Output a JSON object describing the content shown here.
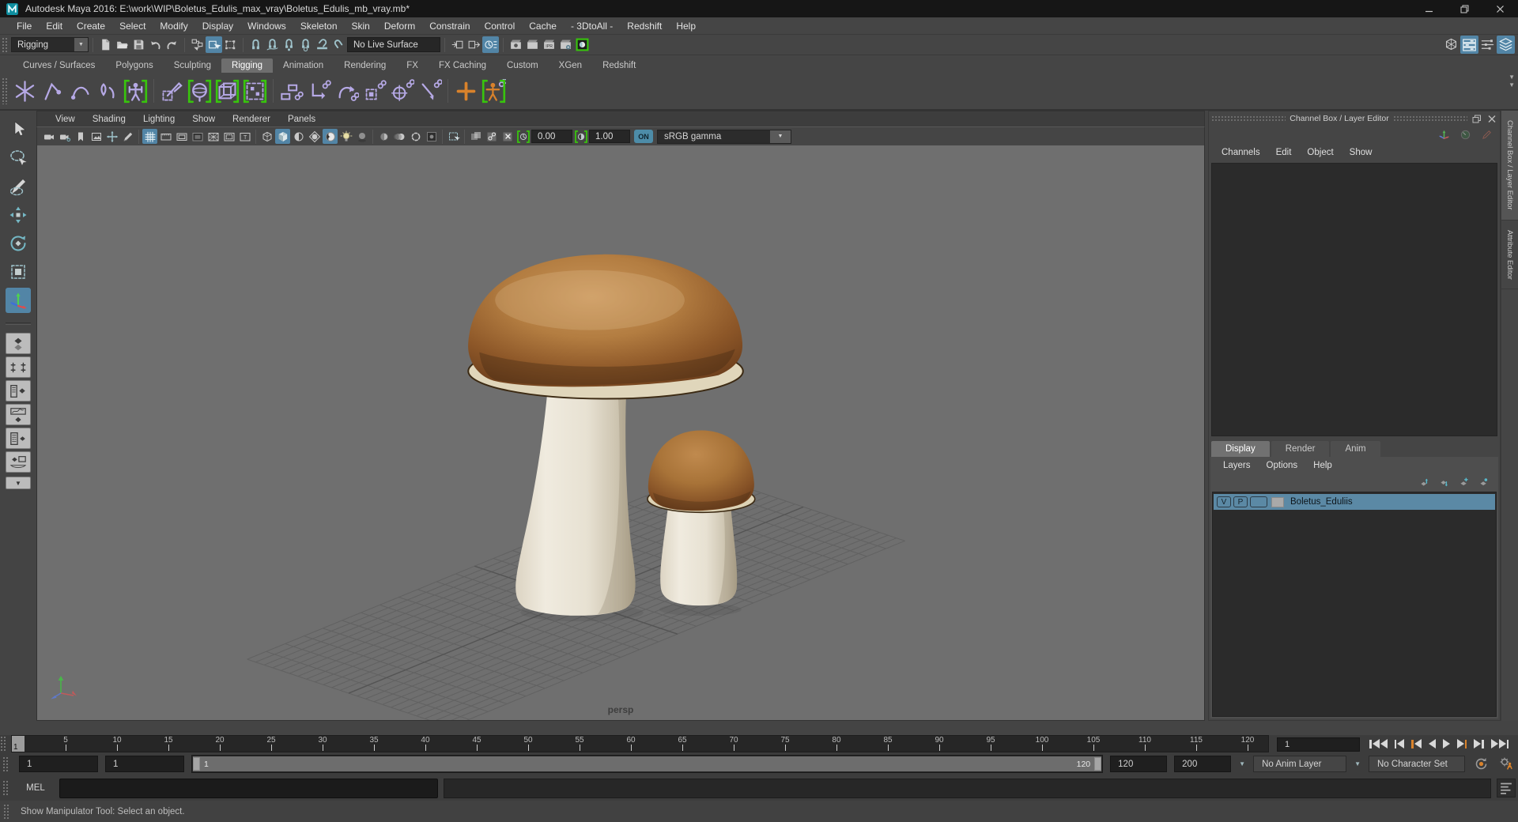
{
  "window": {
    "title": "Autodesk Maya 2016: E:\\work\\WIP\\Boletus_Edulis_max_vray\\Boletus_Edulis_mb_vray.mb*",
    "controls": [
      "minimize",
      "maximize",
      "close"
    ]
  },
  "menubar": {
    "items": [
      "File",
      "Edit",
      "Create",
      "Select",
      "Modify",
      "Display",
      "Windows",
      "Skeleton",
      "Skin",
      "Deform",
      "Constrain",
      "Control",
      "Cache",
      "- 3DtoAll -",
      "Redshift",
      "Help"
    ]
  },
  "statusline": {
    "menu_set": "Rigging",
    "live_surface": "No Live Surface",
    "file_icons": [
      {
        "name": "new-scene-icon"
      },
      {
        "name": "open-scene-icon"
      },
      {
        "name": "save-scene-icon"
      },
      {
        "name": "undo-icon"
      },
      {
        "name": "redo-icon"
      }
    ],
    "selection_icons": [
      {
        "name": "select-hierarchy-icon"
      },
      {
        "name": "select-object-icon",
        "active": true
      },
      {
        "name": "select-component-icon"
      }
    ],
    "snap_icons": [
      {
        "name": "snap-grid-icon"
      },
      {
        "name": "snap-curve-icon"
      },
      {
        "name": "snap-point-icon"
      },
      {
        "name": "snap-projected-center-icon"
      },
      {
        "name": "snap-view-plane-icon"
      },
      {
        "name": "make-live-icon"
      }
    ],
    "history_icons": [
      {
        "name": "input-connections-icon"
      },
      {
        "name": "output-connections-icon"
      },
      {
        "name": "construction-history-icon",
        "active": true
      }
    ],
    "render_icons": [
      {
        "name": "render-view-icon"
      },
      {
        "name": "quick-render-icon"
      },
      {
        "name": "ipr-render-icon"
      },
      {
        "name": "render-settings-icon"
      },
      {
        "name": "redshift-render-view-icon"
      }
    ],
    "sidebar_icons": [
      {
        "name": "modeling-toolkit-icon"
      },
      {
        "name": "attribute-editor-icon",
        "active": true
      },
      {
        "name": "tool-settings-icon"
      },
      {
        "name": "channel-box-icon",
        "active": true
      }
    ]
  },
  "shelf": {
    "tabs": [
      "Curves / Surfaces",
      "Polygons",
      "Sculpting",
      "Rigging",
      "Animation",
      "Rendering",
      "FX",
      "FX Caching",
      "Custom",
      "XGen",
      "Redshift"
    ],
    "active_tab": "Rigging",
    "items": [
      {
        "name": "create-joint-icon"
      },
      {
        "name": "ik-handle-icon"
      },
      {
        "name": "ik-spline-handle-icon"
      },
      {
        "name": "hik-character-icon"
      },
      {
        "name": "quick-rig-icon",
        "bracket": true
      },
      {
        "name": "separator"
      },
      {
        "name": "paint-skin-weights-icon"
      },
      {
        "name": "bind-skin-icon",
        "bracket": true
      },
      {
        "name": "geodesic-voxel-bind-icon",
        "bracket": true
      },
      {
        "name": "interactive-bind-icon",
        "bracket": true
      },
      {
        "name": "separator"
      },
      {
        "name": "parent-constraint-icon"
      },
      {
        "name": "point-constraint-icon"
      },
      {
        "name": "orient-constraint-icon"
      },
      {
        "name": "scale-constraint-icon"
      },
      {
        "name": "aim-constraint-icon"
      },
      {
        "name": "pole-vector-constraint-icon"
      },
      {
        "name": "separator"
      },
      {
        "name": "add-influence-icon"
      },
      {
        "name": "edit-membership-icon",
        "bracket": true
      }
    ]
  },
  "toolbox": {
    "tools": [
      {
        "name": "select-tool"
      },
      {
        "name": "lasso-tool"
      },
      {
        "name": "paint-selection-tool"
      },
      {
        "name": "move-tool"
      },
      {
        "name": "rotate-tool"
      },
      {
        "name": "scale-tool"
      },
      {
        "name": "show-manipulator-tool",
        "active": true
      }
    ],
    "layouts": [
      {
        "name": "single-pane-layout"
      },
      {
        "name": "four-pane-layout"
      },
      {
        "name": "persp-outliner-layout"
      },
      {
        "name": "persp-graph-layout"
      },
      {
        "name": "hypershade-persp-layout"
      },
      {
        "name": "persp-uv-layout"
      }
    ]
  },
  "viewport": {
    "menus": [
      "View",
      "Shading",
      "Lighting",
      "Show",
      "Renderer",
      "Panels"
    ],
    "bar_groups": [
      [
        {
          "name": "camera-icon"
        },
        {
          "name": "camera-attributes-icon"
        },
        {
          "name": "bookmark-icon"
        },
        {
          "name": "image-plane-icon"
        },
        {
          "name": "two-d-pan-zoom-icon"
        },
        {
          "name": "grease-pencil-icon"
        }
      ],
      [
        {
          "name": "grid-icon",
          "active": true
        },
        {
          "name": "film-gate-icon"
        },
        {
          "name": "resolution-gate-icon"
        },
        {
          "name": "gate-mask-icon"
        },
        {
          "name": "field-chart-icon"
        },
        {
          "name": "safe-action-icon"
        },
        {
          "name": "safe-title-icon"
        }
      ],
      [
        {
          "name": "wireframe-icon"
        },
        {
          "name": "smooth-shade-icon",
          "active": true
        },
        {
          "name": "use-all-lights-icon"
        },
        {
          "name": "textured-icon"
        },
        {
          "name": "use-default-material-icon",
          "active": true
        },
        {
          "name": "lighting-icon"
        },
        {
          "name": "shadows-icon"
        }
      ],
      [
        {
          "name": "screen-space-ao-icon"
        },
        {
          "name": "motion-blur-icon"
        },
        {
          "name": "multisample-icon"
        },
        {
          "name": "depth-of-field-icon"
        }
      ],
      [
        {
          "name": "isolate-select-icon"
        }
      ],
      [
        {
          "name": "xray-icon"
        },
        {
          "name": "xray-joints-icon"
        },
        {
          "name": "xray-active-icon"
        }
      ]
    ],
    "exposure_icon": "exposure-icon",
    "exposure_value": "0.00",
    "contrast_icon": "contrast-icon",
    "gamma_value": "1.00",
    "toggle_label": "ON",
    "color_transform": "sRGB gamma",
    "camera_label": "persp"
  },
  "scene": {
    "objects": [
      "boletus-mushroom-large",
      "boletus-mushroom-small"
    ],
    "grid": "ground-plane-grid"
  },
  "channel_box": {
    "title": "Channel Box / Layer Editor",
    "window_icons": [
      {
        "name": "restore-panel-icon"
      },
      {
        "name": "close-panel-icon"
      }
    ],
    "corner_icons": [
      {
        "name": "manipulator-icon"
      },
      {
        "name": "speed-dial-icon"
      },
      {
        "name": "pencil-icon"
      }
    ],
    "menus": [
      "Channels",
      "Edit",
      "Object",
      "Show"
    ],
    "side_tabs": [
      {
        "label": "Channel Box / Layer Editor",
        "active": true
      },
      {
        "label": "Attribute Editor",
        "active": false
      }
    ]
  },
  "layer_editor": {
    "tabs": [
      "Display",
      "Render",
      "Anim"
    ],
    "active_tab": "Display",
    "menus": [
      "Layers",
      "Options",
      "Help"
    ],
    "action_icons": [
      {
        "name": "move-layer-up-icon"
      },
      {
        "name": "move-layer-down-icon"
      },
      {
        "name": "new-empty-layer-icon"
      },
      {
        "name": "new-layer-from-selected-icon"
      }
    ],
    "layers": [
      {
        "visibility": "V",
        "playback": "P",
        "name": "Boletus_Eduliis",
        "selected": true
      }
    ]
  },
  "timeline": {
    "current_frame": "1",
    "ticks": [
      5,
      10,
      15,
      20,
      25,
      30,
      35,
      40,
      45,
      50,
      55,
      60,
      65,
      70,
      75,
      80,
      85,
      90,
      95,
      100,
      105,
      110,
      115,
      120
    ],
    "tick_range_end": 122,
    "frame_field": "1",
    "playback_icons": [
      "go-to-start-icon",
      "step-back-frame-icon",
      "step-back-key-icon",
      "play-backwards-icon",
      "play-forwards-icon",
      "step-forward-key-icon",
      "step-forward-frame-icon",
      "go-to-end-icon"
    ]
  },
  "range_slider": {
    "anim_start": "1",
    "playback_start": "1",
    "bar_start_label": "1",
    "bar_end_label": "120",
    "playback_end": "120",
    "anim_end": "200",
    "anim_layer": "No Anim Layer",
    "character_set": "No Character Set",
    "icons": [
      {
        "name": "auto-keyframe-icon"
      },
      {
        "name": "animation-preferences-icon"
      }
    ]
  },
  "command_line": {
    "label": "MEL"
  },
  "help_line": {
    "text": "Show Manipulator Tool: Select an object."
  },
  "colors": {
    "accent_blue": "#5285a6",
    "shelf_purple": "#b6a9e6",
    "bracket_green": "#38c40d",
    "accent_orange": "#d9822b",
    "viewport_bg": "#6f6f6f",
    "layer_selected": "#5b89a5",
    "cap_brown": "#a9713a",
    "stem_cream": "#ebe5d7"
  }
}
